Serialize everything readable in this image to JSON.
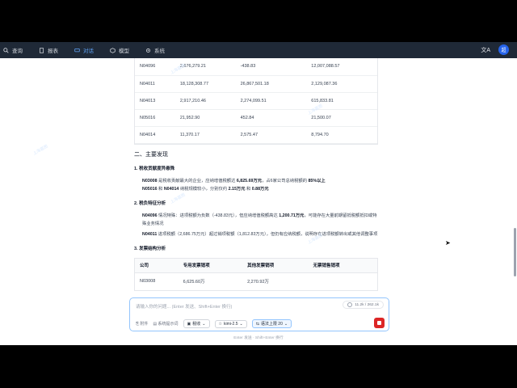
{
  "nav": {
    "items": [
      {
        "label": "查询",
        "icon": "search-icon"
      },
      {
        "label": "报表",
        "icon": "document-icon"
      },
      {
        "label": "对话",
        "icon": "chat-icon",
        "active": true
      },
      {
        "label": "模型",
        "icon": "cube-icon"
      },
      {
        "label": "系统",
        "icon": "gear-icon"
      }
    ],
    "avatar": "超"
  },
  "top_table": {
    "rows": [
      [
        "N04096",
        "2,676,279.21",
        "-438.83",
        "12,007,088.57"
      ],
      [
        "N04011",
        "18,128,308.77",
        "26,867,501.18",
        "2,129,087.36"
      ],
      [
        "N04013",
        "2,917,210.46",
        "2,274,099.51",
        "615,833.81"
      ],
      [
        "N05016",
        "21,952.90",
        "452.84",
        "21,500.07"
      ],
      [
        "N04014",
        "11,370.17",
        "2,575.47",
        "8,794.70"
      ]
    ]
  },
  "section": {
    "title": "二、主要发现",
    "p1_heading": "1. 税收贡献度异悬殊",
    "p1_b1_strong": "N03008",
    "p1_b1_text": " 是税收贡献最大的企业，应纳增值税额达 ",
    "p1_b1_strong2": "6,825.69万元",
    "p1_b1_text2": "，占6家公司总纳税额的 ",
    "p1_b1_strong3": "85%以上",
    "p1_b2_strong": "N05016",
    "p1_b2_text": " 和 ",
    "p1_b2_strong2": "N04014",
    "p1_b2_text2": " 纳税规模较小，分别仅约 ",
    "p1_b2_strong3": "2.15万元",
    "p1_b2_text3": " 和 ",
    "p1_b2_strong4": "0.88万元",
    "p2_heading": "2. 税负特征分析",
    "p2_b1_strong": "N04096",
    "p2_b1_text": " 情况特殊：进项税额为负数（-438.83元），但应纳增值税额高达 ",
    "p2_b1_strong2": "1,200.71万元",
    "p2_b1_text2": "，可能存在大量前期留抵税额抵扣或特殊业务情况",
    "p2_b2_strong": "N04011",
    "p2_b2_text": " 进项税额（2,686.75万元）超过销项税额（1,812.83万元），但仍有应纳税额，说明存在进项税额转出或其他调整事项",
    "p3_heading": "3. 发票结构分析"
  },
  "invoice_table": {
    "headers": [
      "公司",
      "专用发票销项",
      "其他发票销项",
      "无票销售销项"
    ],
    "row": [
      "N03008",
      "6,625.60万",
      "2,270.92万",
      ""
    ]
  },
  "composer": {
    "placeholder": "请输入你的问题... (Enter 发送、Shift+Enter 换行)",
    "token_count": "11.2k / 262.1k",
    "attach_label": "附件",
    "kb_label": "系统提示词",
    "tax_label": "税收",
    "model_label": "kimi-2.5",
    "context_label": "语法上限 20",
    "hint": "Enter 发送 · Shift+Enter 换行"
  },
  "watermark": "上海嘉图"
}
